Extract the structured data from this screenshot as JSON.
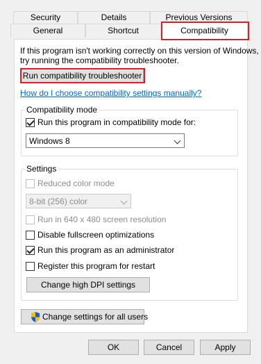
{
  "tabs": {
    "row1": [
      "Security",
      "Details",
      "Previous Versions"
    ],
    "row2": [
      "General",
      "Shortcut",
      "Compatibility"
    ]
  },
  "intro": {
    "line1": "If this program isn't working correctly on this version of Windows,",
    "line2": "try running the compatibility troubleshooter."
  },
  "troubleshooter_button": "Run compatibility troubleshooter",
  "manual_link": "How do I choose compatibility settings manually?",
  "compat_mode": {
    "title": "Compatibility mode",
    "checkbox_label": "Run this program in compatibility mode for:",
    "checked": true,
    "selected_os": "Windows 8"
  },
  "settings": {
    "title": "Settings",
    "reduced_color": {
      "label": "Reduced color mode",
      "checked": false,
      "enabled": false
    },
    "color_select": "8-bit (256) color",
    "res640": {
      "label": "Run in 640 x 480 screen resolution",
      "checked": false,
      "enabled": false
    },
    "disable_fullscreen": {
      "label": "Disable fullscreen optimizations",
      "checked": false
    },
    "run_admin": {
      "label": "Run this program as an administrator",
      "checked": true
    },
    "register_restart": {
      "label": "Register this program for restart",
      "checked": false
    },
    "dpi_button": "Change high DPI settings"
  },
  "all_users_button": "Change settings for all users",
  "footer": {
    "ok": "OK",
    "cancel": "Cancel",
    "apply": "Apply"
  },
  "colors": {
    "highlight": "#d9202a",
    "link": "#0066cc",
    "shield_blue": "#1e5bc6",
    "shield_gold": "#f2c200"
  }
}
